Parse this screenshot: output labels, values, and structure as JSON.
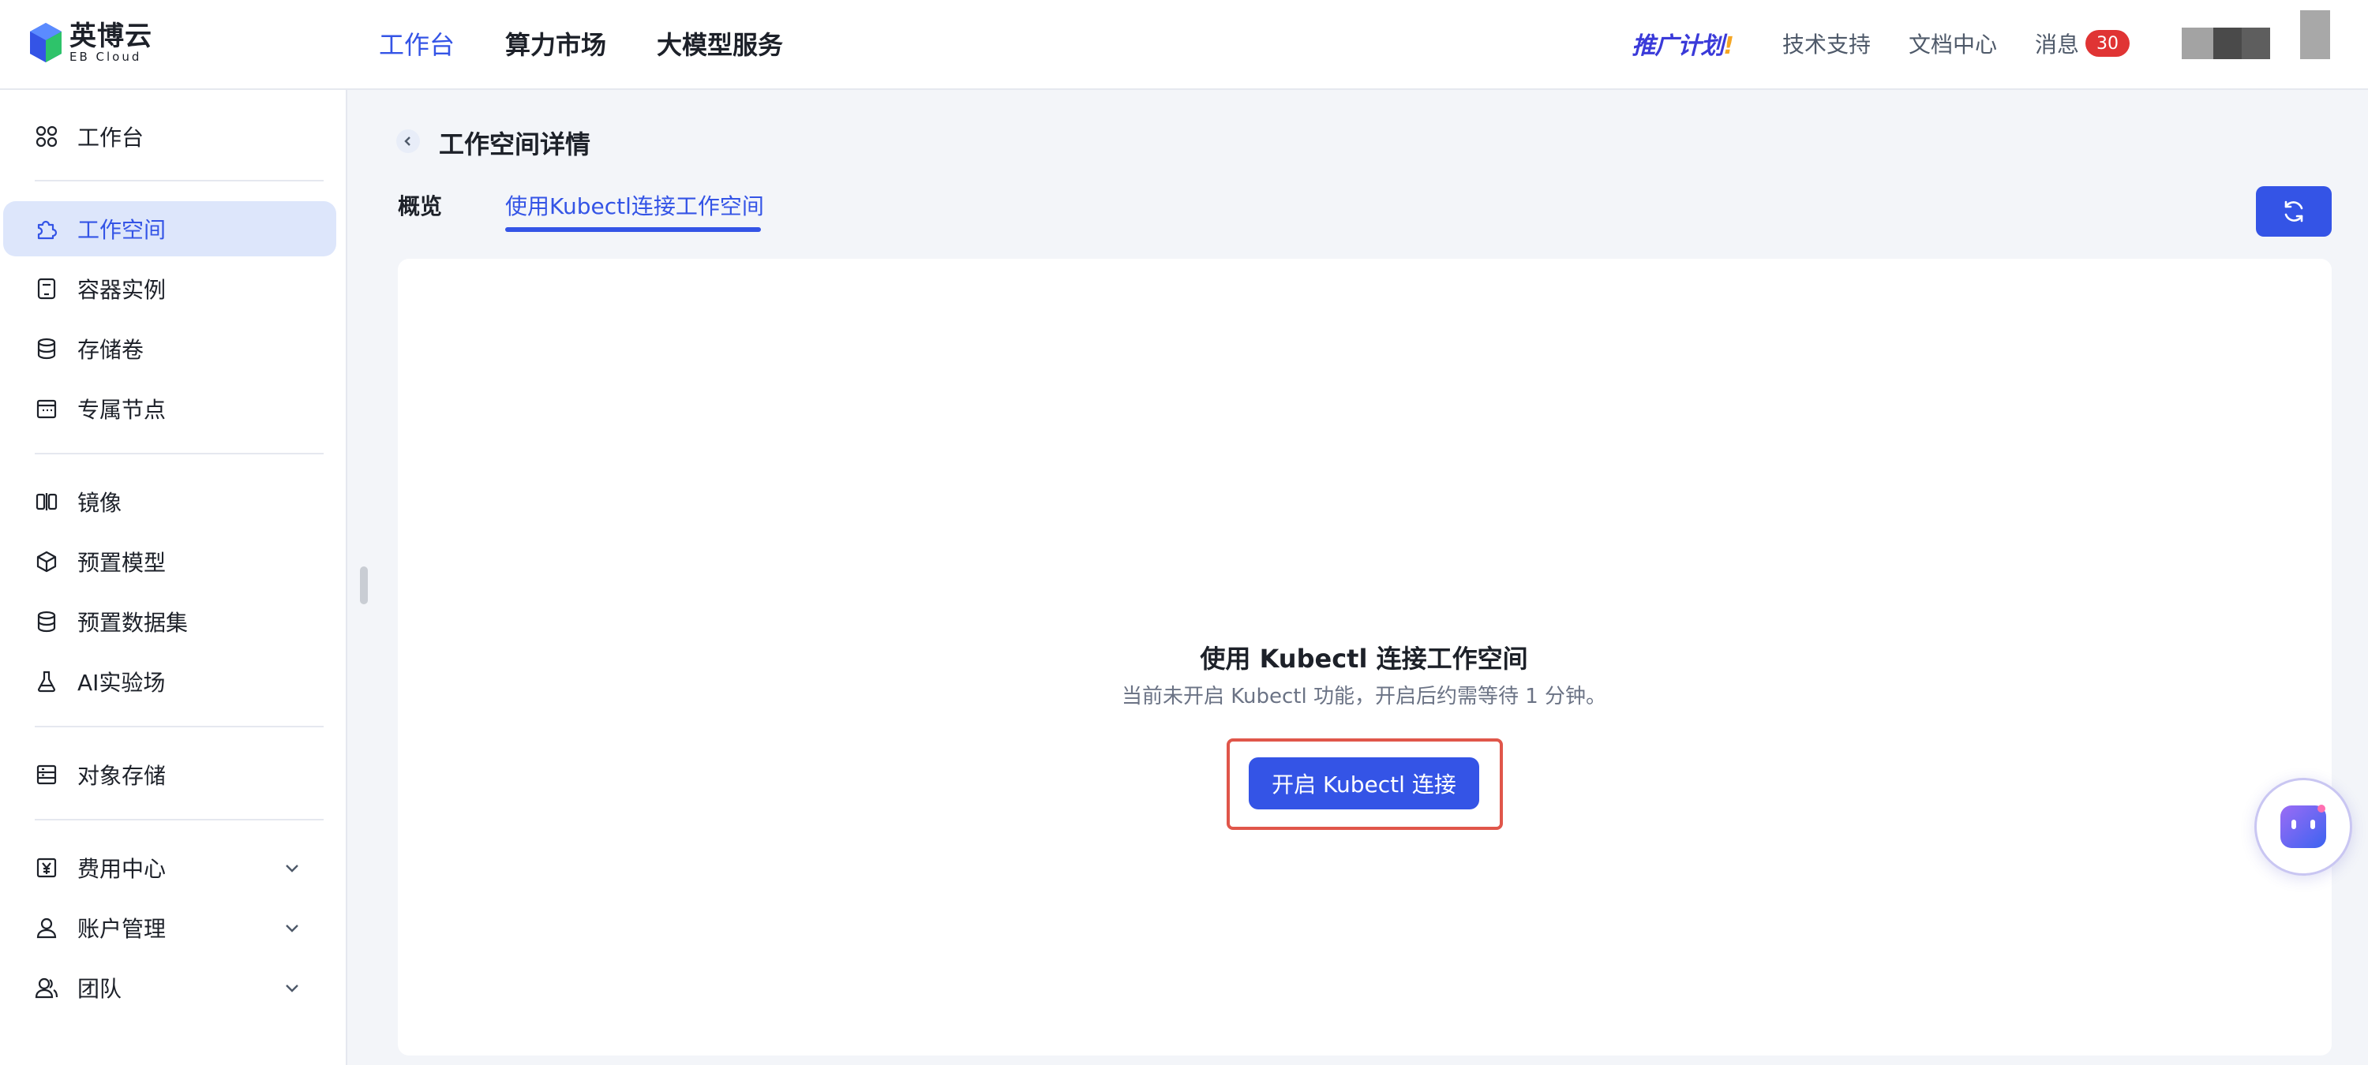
{
  "brand": {
    "name_cn": "英博云",
    "name_en": "EB Cloud",
    "accent": "#3454e6"
  },
  "topnav": [
    {
      "label": "工作台",
      "active": true
    },
    {
      "label": "算力市场",
      "active": false
    },
    {
      "label": "大模型服务",
      "active": false
    }
  ],
  "top_right": {
    "promo": "推广计划",
    "promo_dot": "!",
    "support": "技术支持",
    "docs": "文档中心",
    "messages": "消息",
    "message_count": "30"
  },
  "sidebar": {
    "items": [
      {
        "label": "工作台",
        "icon": "grid-icon"
      },
      {
        "label": "工作空间",
        "icon": "puzzle-icon",
        "active": true
      },
      {
        "label": "容器实例",
        "icon": "container-icon"
      },
      {
        "label": "存储卷",
        "icon": "database-icon"
      },
      {
        "label": "专属节点",
        "icon": "calendar-icon"
      },
      {
        "label": "镜像",
        "icon": "mirror-icon"
      },
      {
        "label": "预置模型",
        "icon": "cube-icon"
      },
      {
        "label": "预置数据集",
        "icon": "database-icon"
      },
      {
        "label": "AI实验场",
        "icon": "flask-icon"
      },
      {
        "label": "对象存储",
        "icon": "storage-icon"
      },
      {
        "label": "费用中心",
        "icon": "yen-icon",
        "expandable": true
      },
      {
        "label": "账户管理",
        "icon": "user-icon",
        "expandable": true
      },
      {
        "label": "团队",
        "icon": "team-icon",
        "expandable": true
      }
    ]
  },
  "main": {
    "title": "工作空间详情",
    "tabs": [
      {
        "label": "概览",
        "active": false
      },
      {
        "label": "使用Kubectl连接工作空间",
        "active": true
      }
    ],
    "empty_state": {
      "title": "使用 Kubectl 连接工作空间",
      "subtitle": "当前未开启 Kubectl 功能，开启后约需等待 1 分钟。",
      "button": "开启 Kubectl 连接"
    }
  }
}
